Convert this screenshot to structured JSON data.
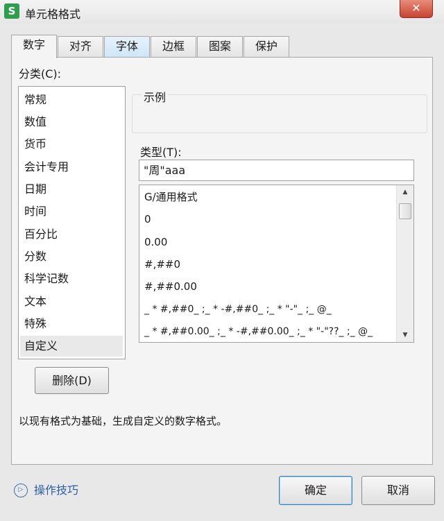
{
  "window": {
    "app_icon_letter": "S",
    "title": "单元格格式",
    "close_glyph": "✕"
  },
  "tabs": [
    {
      "label": "数字",
      "state": "active"
    },
    {
      "label": "对齐",
      "state": "normal"
    },
    {
      "label": "字体",
      "state": "hover"
    },
    {
      "label": "边框",
      "state": "normal"
    },
    {
      "label": "图案",
      "state": "normal"
    },
    {
      "label": "保护",
      "state": "normal"
    }
  ],
  "category": {
    "label": "分类(C):",
    "items": [
      "常规",
      "数值",
      "货币",
      "会计专用",
      "日期",
      "时间",
      "百分比",
      "分数",
      "科学记数",
      "文本",
      "特殊",
      "自定义"
    ],
    "selected": "自定义"
  },
  "example": {
    "label": "示例",
    "value": ""
  },
  "type": {
    "label": "类型(T):",
    "value": "\"周\"aaa"
  },
  "formats": [
    "G/通用格式",
    "0",
    "0.00",
    "#,##0",
    "#,##0.00",
    "_ * #,##0_ ;_ * -#,##0_ ;_ * \"-\"_ ;_ @_",
    "_ * #,##0.00_ ;_ * -#,##0.00_ ;_ * \"-\"??_ ;_ @_"
  ],
  "scroll": {
    "up": "▲",
    "down": "▼"
  },
  "buttons": {
    "delete": "删除(D)",
    "ok": "确定",
    "cancel": "取消"
  },
  "description": "以现有格式为基础，生成自定义的数字格式。",
  "tips": {
    "icon_glyph": "▷",
    "label": "操作技巧"
  },
  "colors": {
    "accent": "#3c7fb1",
    "close": "#c74330",
    "link": "#2a5ea8",
    "app_icon": "#2e9e4e"
  }
}
